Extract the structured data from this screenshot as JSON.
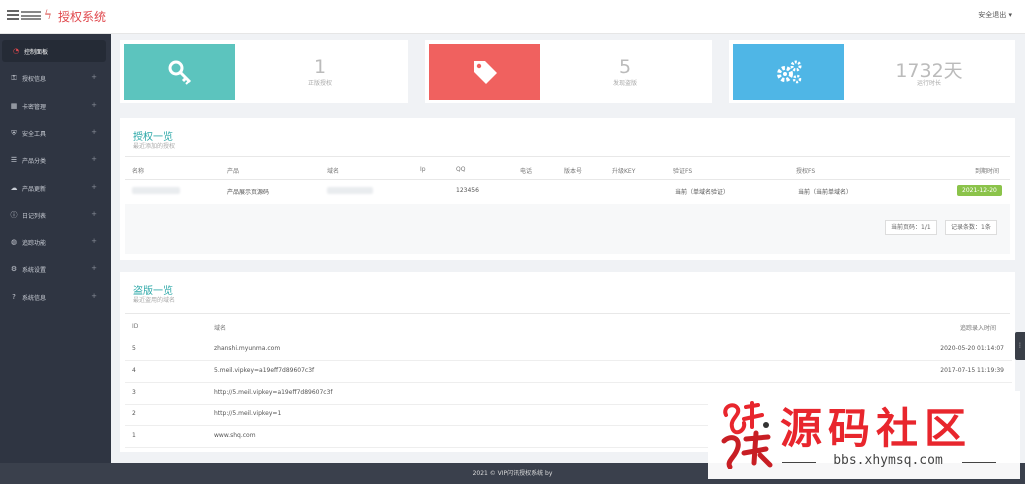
{
  "header": {
    "logo_icon": "ϟ",
    "title": "授权系统",
    "logout": "安全退出 ▾"
  },
  "sidebar": {
    "items": [
      {
        "label": "控制面板",
        "icon": "dashboard-icon",
        "glyph": "◔",
        "active": true
      },
      {
        "label": "授权信息",
        "icon": "key-icon",
        "glyph": "⚿",
        "plus": "+"
      },
      {
        "label": "卡密管理",
        "icon": "card-icon",
        "glyph": "▦",
        "plus": "+"
      },
      {
        "label": "安全工具",
        "icon": "shield-icon",
        "glyph": "⛨",
        "plus": "+"
      },
      {
        "label": "产品分类",
        "icon": "list-icon",
        "glyph": "☰",
        "plus": "+"
      },
      {
        "label": "产品更新",
        "icon": "cloud-icon",
        "glyph": "☁",
        "plus": "+"
      },
      {
        "label": "日记列表",
        "icon": "info-icon",
        "glyph": "ⓘ",
        "plus": "+"
      },
      {
        "label": "追踪功能",
        "icon": "globe-icon",
        "glyph": "◍",
        "plus": "+"
      },
      {
        "label": "系统设置",
        "icon": "gears-icon",
        "glyph": "⚙",
        "plus": "+"
      },
      {
        "label": "系统信息",
        "icon": "question-icon",
        "glyph": "?",
        "plus": "+"
      }
    ]
  },
  "stats": [
    {
      "value": "1",
      "label": "正版授权",
      "color": "#5cc4be",
      "icon": "key-icon"
    },
    {
      "value": "5",
      "label": "发现盗版",
      "color": "#f0615f",
      "icon": "tag-icon"
    },
    {
      "value": "1732天",
      "label": "运行时长",
      "color": "#4fb6e6",
      "icon": "gears-icon"
    }
  ],
  "auth_panel": {
    "title": "授权一览",
    "subtitle": "最近添加的授权",
    "columns": [
      "名称",
      "产品",
      "域名",
      "Ip",
      "QQ",
      "电话",
      "版本号",
      "升级KEY",
      "验证FS",
      "授权FS",
      "到期时间"
    ],
    "row": {
      "product": "产品展示页源码",
      "qq": "123456",
      "verify_fs": "当前（单域名验证）",
      "auth_fs": "当前（当前单域名）",
      "expire": "2021-12-20"
    },
    "pager_current": "当前页码：1/1",
    "pager_count": "记录条数：1条"
  },
  "piracy_panel": {
    "title": "盗版一览",
    "subtitle": "最近盗用的域名",
    "columns": [
      "ID",
      "域名",
      "追踪录入时间"
    ],
    "rows": [
      {
        "id": "5",
        "domain": "zhanshi.myunma.com",
        "time": "2020-05-20 01:14:07"
      },
      {
        "id": "4",
        "domain": "5.meil.vipkey=a19eff7d89607c3f",
        "time": "2017-07-15 11:19:39"
      },
      {
        "id": "3",
        "domain": "http://5.meil.vipkey=a19eff7d89607c3f",
        "time": ""
      },
      {
        "id": "2",
        "domain": "http://5.meil.vipkey=1",
        "time": ""
      },
      {
        "id": "1",
        "domain": "www.shq.com",
        "time": ""
      }
    ]
  },
  "footer": {
    "text": "2021 © VIP闪讯授权系统 by"
  },
  "scroll_tab": "⋮",
  "watermark": {
    "title": "源码社区",
    "url": "bbs.xhymsq.com",
    "seal_text": "小猿"
  }
}
